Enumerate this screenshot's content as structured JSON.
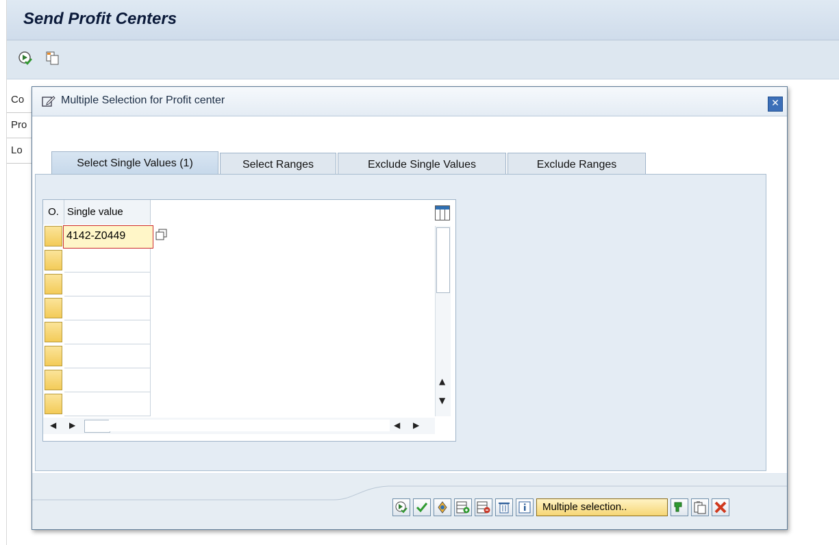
{
  "window": {
    "title": "Send Profit Centers",
    "background_labels": [
      "Co",
      "Pro",
      "Lo"
    ]
  },
  "toolbar": {
    "icons": [
      "execute-icon",
      "copy-variant-icon"
    ]
  },
  "dialog": {
    "title": "Multiple Selection for Profit center",
    "tabs": [
      {
        "label": "Select Single Values (1)"
      },
      {
        "label": "Select Ranges"
      },
      {
        "label": "Exclude Single Values"
      },
      {
        "label": "Exclude Ranges"
      }
    ],
    "table": {
      "col_o": "O.",
      "col_value": "Single value",
      "rows": [
        "4142-Z0449",
        "",
        "",
        "",
        "",
        "",
        "",
        ""
      ]
    },
    "buttons": {
      "multiple_selection_label": "Multiple selection.."
    }
  },
  "colors": {
    "accent": "#3c6fb8",
    "selection_yellow": "#f3cb58",
    "panel_bg": "#e4ecf4"
  }
}
